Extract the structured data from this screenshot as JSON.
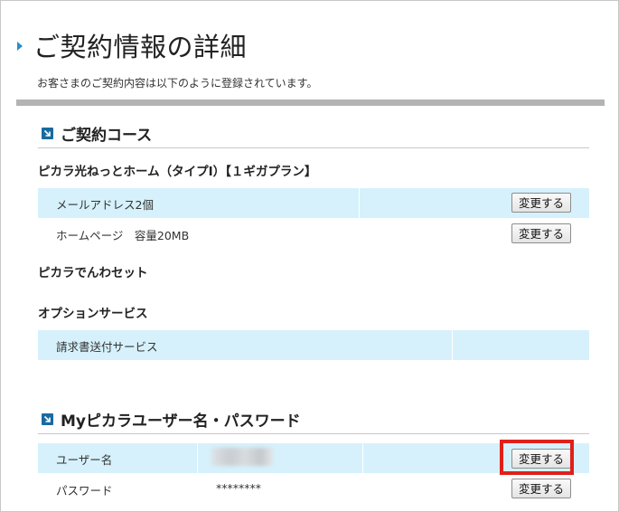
{
  "page": {
    "title": "ご契約情報の詳細",
    "subtitle": "お客さまのご契約内容は以下のように登録されています。"
  },
  "course": {
    "heading": "ご契約コース",
    "plan_name": "ピカラ光ねっとホーム（タイプⅠ）【１ギガプラン】",
    "rows": [
      {
        "label": "メールアドレス2個",
        "button": "変更する"
      },
      {
        "label": "ホームページ　容量20MB",
        "button": "変更する"
      }
    ],
    "phone_set": "ピカラでんわセット",
    "option_heading": "オプションサービス",
    "option_rows": [
      {
        "label": "請求書送付サービス"
      }
    ]
  },
  "account": {
    "heading": "Myピカラユーザー名・パスワード",
    "rows": [
      {
        "label": "ユーザー名",
        "value": "",
        "button": "変更する"
      },
      {
        "label": "パスワード",
        "value": "********",
        "button": "変更する"
      }
    ]
  },
  "colors": {
    "accent": "#2a8fc7",
    "section_icon": "#1a6aa0",
    "row_shade": "#d6f1fb",
    "highlight": "#e0201a",
    "gray_bar": "#b3b3b3"
  },
  "icons": {
    "title_marker": "triangle-right-icon",
    "section_marker": "arrow-down-right-icon"
  }
}
